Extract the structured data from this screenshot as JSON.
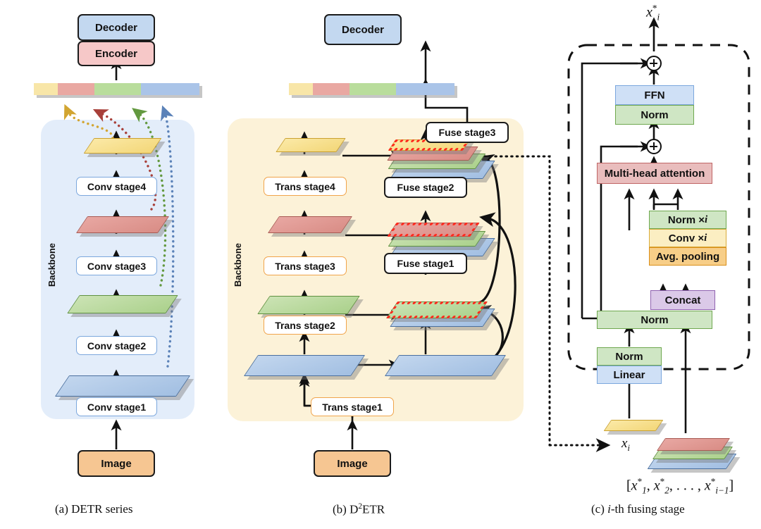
{
  "figure": {
    "panels": [
      {
        "id": "a",
        "caption_prefix": "(a)",
        "caption_text": "DETR series",
        "backbone_label": "Backbone",
        "top_blocks": [
          {
            "name": "decoder",
            "label": "Decoder",
            "color": "#c3d8f0"
          },
          {
            "name": "encoder",
            "label": "Encoder",
            "color": "#f6c8c8"
          }
        ],
        "stage_blocks": [
          {
            "label": "Conv stage4"
          },
          {
            "label": "Conv stage3"
          },
          {
            "label": "Conv stage2"
          },
          {
            "label": "Conv stage1"
          }
        ],
        "input_label": "Image",
        "token_bar": [
          {
            "color": "#f8e6a8",
            "width": 34
          },
          {
            "color": "#e9a8a2",
            "width": 52
          },
          {
            "color": "#b9dd9c",
            "width": 66
          },
          {
            "color": "#aac4e8",
            "width": 83
          }
        ],
        "feature_maps": [
          {
            "color": "yellow"
          },
          {
            "color": "red"
          },
          {
            "color": "green"
          },
          {
            "color": "blue"
          }
        ]
      },
      {
        "id": "b",
        "caption_prefix": "(b)",
        "caption_text": "D²ETR",
        "backbone_label": "Backbone",
        "top_blocks": [
          {
            "name": "decoder",
            "label": "Decoder",
            "color": "#c3d8f0"
          }
        ],
        "stage_blocks": [
          {
            "label": "Trans stage4"
          },
          {
            "label": "Trans stage3"
          },
          {
            "label": "Trans stage2"
          },
          {
            "label": "Trans stage1"
          }
        ],
        "fuse_blocks": [
          {
            "label": "Fuse stage3"
          },
          {
            "label": "Fuse stage2"
          },
          {
            "label": "Fuse stage1"
          }
        ],
        "input_label": "Image",
        "token_bar": [
          {
            "color": "#f8e6a8",
            "width": 34
          },
          {
            "color": "#e9a8a2",
            "width": 52
          },
          {
            "color": "#b9dd9c",
            "width": 66
          },
          {
            "color": "#aac4e8",
            "width": 83
          }
        ],
        "highlight_color": "#ff2b1f"
      },
      {
        "id": "c",
        "caption_prefix": "(c)",
        "caption_text": "-th fusing stage",
        "caption_italic": "i",
        "output_label": "x*i",
        "blocks": [
          {
            "name": "ffn",
            "label": "FFN",
            "color": "#cfe0f6"
          },
          {
            "name": "norm-post-attn",
            "label": "Norm",
            "color": "#cfe6c4"
          },
          {
            "name": "multi-head-attention",
            "label": "Multi-head attention",
            "color": "#e9bdbd"
          },
          {
            "name": "norm-times-i",
            "label": "Norm × i",
            "color": "#cfe6c4"
          },
          {
            "name": "conv-times-i",
            "label": "Conv × i",
            "color": "#fbeec2"
          },
          {
            "name": "avg-pooling",
            "label": "Avg. pooling",
            "color": "#f7ce88"
          },
          {
            "name": "concat",
            "label": "Concat",
            "color": "#dbc9e8"
          },
          {
            "name": "norm-wide",
            "label": "Norm",
            "color": "#cfe6c4"
          },
          {
            "name": "norm-small",
            "label": "Norm",
            "color": "#cfe6c4"
          },
          {
            "name": "linear",
            "label": "Linear",
            "color": "#cfe0f6"
          }
        ],
        "input_x_label": "xi",
        "input_stack_label": "[x*1, x*2, ..., x*i-1]"
      }
    ]
  },
  "labels": {
    "decoder": "Decoder",
    "encoder": "Encoder",
    "image": "Image",
    "backbone": "Backbone",
    "conv_stage4": "Conv stage4",
    "conv_stage3": "Conv stage3",
    "conv_stage2": "Conv stage2",
    "conv_stage1": "Conv stage1",
    "trans_stage4": "Trans stage4",
    "trans_stage3": "Trans stage3",
    "trans_stage2": "Trans stage2",
    "trans_stage1": "Trans stage1",
    "fuse_stage3": "Fuse stage3",
    "fuse_stage2": "Fuse stage2",
    "fuse_stage1": "Fuse stage1",
    "ffn": "FFN",
    "norm": "Norm",
    "multi_head_attention": "Multi-head attention",
    "norm_times_i": "Norm × ",
    "conv_times_i": "Conv × ",
    "avg_pooling": "Avg. pooling",
    "concat": "Concat",
    "linear": "Linear",
    "i_symbol": "i"
  },
  "captions": {
    "a_prefix": "(a)",
    "a_text": "DETR series",
    "b_prefix": "(b)",
    "b_text": "ETR",
    "b_d": "D",
    "b_sup": "2",
    "c_prefix": "(c)",
    "c_italic": "i",
    "c_text": "-th fusing stage"
  },
  "colors": {
    "backbone_a_bg": "#e3edfa",
    "backbone_b_bg": "#fcf2d8",
    "highlight": "#ff2b1f",
    "yellow": "#f3d779",
    "red": "#d98d86",
    "green": "#abd18c",
    "blue": "#a2bfe2",
    "decoder": "#c3d8f0",
    "encoder": "#f6c8c8",
    "image": "#f6c692"
  }
}
